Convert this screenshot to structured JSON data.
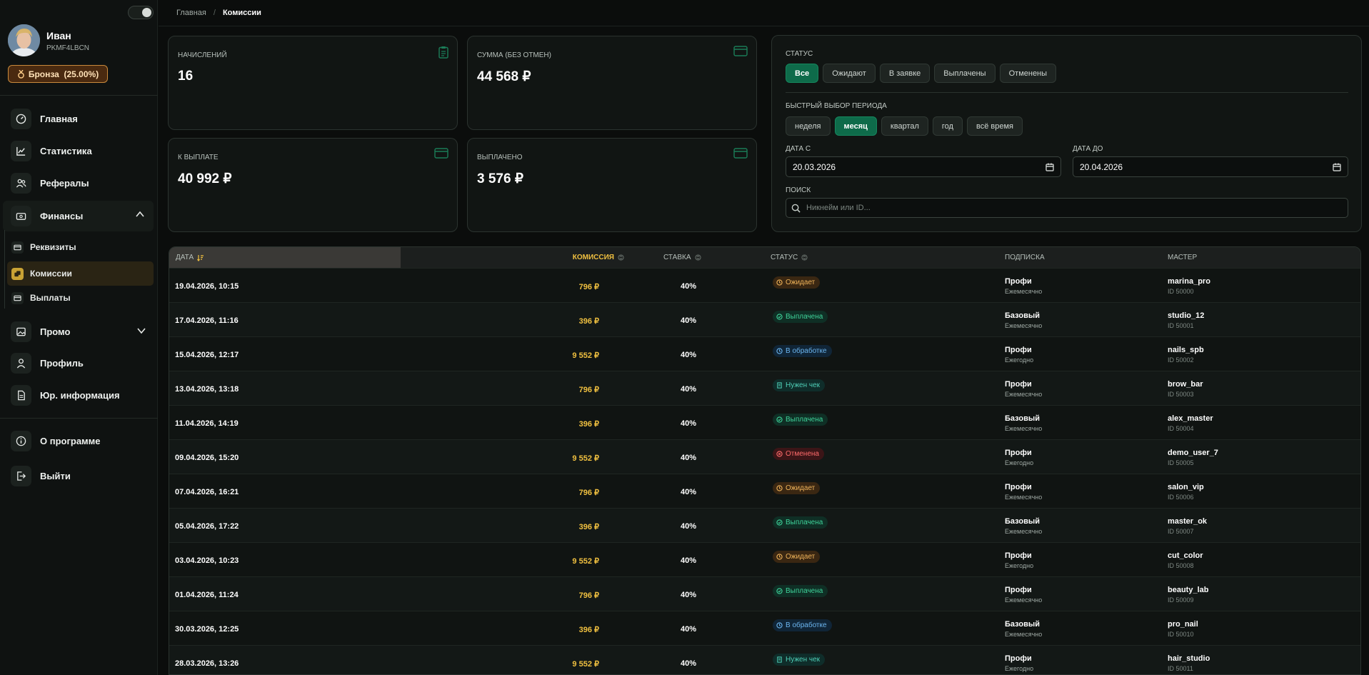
{
  "user": {
    "name": "Иван",
    "code": "PKMF4LBCN",
    "rank": "Бронза  (25.00%)"
  },
  "nav": {
    "home": "Главная",
    "stats": "Статистика",
    "referrals": "Рефералы",
    "finance": "Финансы",
    "finance_sub": [
      "Реквизиты",
      "Комиссии",
      "Выплаты"
    ],
    "promo": "Промо",
    "profile": "Профиль",
    "legal": "Юр. информация",
    "about": "О программе",
    "logout": "Выйти"
  },
  "breadcrumb": {
    "home": "Главная",
    "sep": "/",
    "current": "Комиссии"
  },
  "stats": [
    {
      "label": "НАЧИСЛЕНИЙ",
      "value": "16"
    },
    {
      "label": "СУММА (БЕЗ ОТМЕН)",
      "value": "44 568 ₽"
    },
    {
      "label": "К ВЫПЛАТЕ",
      "value": "40 992 ₽"
    },
    {
      "label": "ВЫПЛАЧЕНО",
      "value": "3 576 ₽"
    }
  ],
  "filters": {
    "status_label": "СТАТУС",
    "status_options": [
      "Все",
      "Ожидают",
      "В заявке",
      "Выплачены",
      "Отменены"
    ],
    "status_selected": "Все",
    "period_label": "БЫСТРЫЙ ВЫБОР ПЕРИОДА",
    "period_options": [
      "неделя",
      "месяц",
      "квартал",
      "год",
      "всё время"
    ],
    "period_selected": "месяц",
    "date_from_label": "ДАТА С",
    "date_from": "20.03.2026",
    "date_to_label": "ДАТА ДО",
    "date_to": "20.04.2026",
    "search_label": "ПОИСК",
    "search_placeholder": "Никнейм или ID..."
  },
  "table": {
    "columns": {
      "date": "ДАТА",
      "commission": "КОМИССИЯ",
      "rate": "СТАВКА",
      "status": "СТАТУС",
      "subscription": "ПОДПИСКА",
      "master": "МАСТЕР"
    },
    "rows": [
      {
        "date": "19.04.2026, 10:15",
        "commission": "796 ₽",
        "rate": "40%",
        "status": "Ожидает",
        "status_type": "pend",
        "plan": "Профи",
        "period": "Ежемесячно",
        "master": "marina_pro",
        "master_id": "ID 50000"
      },
      {
        "date": "17.04.2026, 11:16",
        "commission": "396 ₽",
        "rate": "40%",
        "status": "Выплачена",
        "status_type": "paid",
        "plan": "Базовый",
        "period": "Ежемесячно",
        "master": "studio_12",
        "master_id": "ID 50001"
      },
      {
        "date": "15.04.2026, 12:17",
        "commission": "9 552 ₽",
        "rate": "40%",
        "status": "В обработке",
        "status_type": "proc",
        "plan": "Профи",
        "period": "Ежегодно",
        "master": "nails_spb",
        "master_id": "ID 50002"
      },
      {
        "date": "13.04.2026, 13:18",
        "commission": "796 ₽",
        "rate": "40%",
        "status": "Нужен чек",
        "status_type": "chk",
        "plan": "Профи",
        "period": "Ежемесячно",
        "master": "brow_bar",
        "master_id": "ID 50003"
      },
      {
        "date": "11.04.2026, 14:19",
        "commission": "396 ₽",
        "rate": "40%",
        "status": "Выплачена",
        "status_type": "paid",
        "plan": "Базовый",
        "period": "Ежемесячно",
        "master": "alex_master",
        "master_id": "ID 50004"
      },
      {
        "date": "09.04.2026, 15:20",
        "commission": "9 552 ₽",
        "rate": "40%",
        "status": "Отменена",
        "status_type": "canc",
        "plan": "Профи",
        "period": "Ежегодно",
        "master": "demo_user_7",
        "master_id": "ID 50005"
      },
      {
        "date": "07.04.2026, 16:21",
        "commission": "796 ₽",
        "rate": "40%",
        "status": "Ожидает",
        "status_type": "pend",
        "plan": "Профи",
        "period": "Ежемесячно",
        "master": "salon_vip",
        "master_id": "ID 50006"
      },
      {
        "date": "05.04.2026, 17:22",
        "commission": "396 ₽",
        "rate": "40%",
        "status": "Выплачена",
        "status_type": "paid",
        "plan": "Базовый",
        "period": "Ежемесячно",
        "master": "master_ok",
        "master_id": "ID 50007"
      },
      {
        "date": "03.04.2026, 10:23",
        "commission": "9 552 ₽",
        "rate": "40%",
        "status": "Ожидает",
        "status_type": "pend",
        "plan": "Профи",
        "period": "Ежегодно",
        "master": "cut_color",
        "master_id": "ID 50008"
      },
      {
        "date": "01.04.2026, 11:24",
        "commission": "796 ₽",
        "rate": "40%",
        "status": "Выплачена",
        "status_type": "paid",
        "plan": "Профи",
        "period": "Ежемесячно",
        "master": "beauty_lab",
        "master_id": "ID 50009"
      },
      {
        "date": "30.03.2026, 12:25",
        "commission": "396 ₽",
        "rate": "40%",
        "status": "В обработке",
        "status_type": "proc",
        "plan": "Базовый",
        "period": "Ежемесячно",
        "master": "pro_nail",
        "master_id": "ID 50010"
      },
      {
        "date": "28.03.2026, 13:26",
        "commission": "9 552 ₽",
        "rate": "40%",
        "status": "Нужен чек",
        "status_type": "chk",
        "plan": "Профи",
        "period": "Ежегодно",
        "master": "hair_studio",
        "master_id": "ID 50011"
      }
    ]
  },
  "colors": {
    "accent": "#0e6b4a",
    "gold": "#f0c040",
    "bronze": "#c98a3c",
    "bg": "#0b0d0c"
  }
}
